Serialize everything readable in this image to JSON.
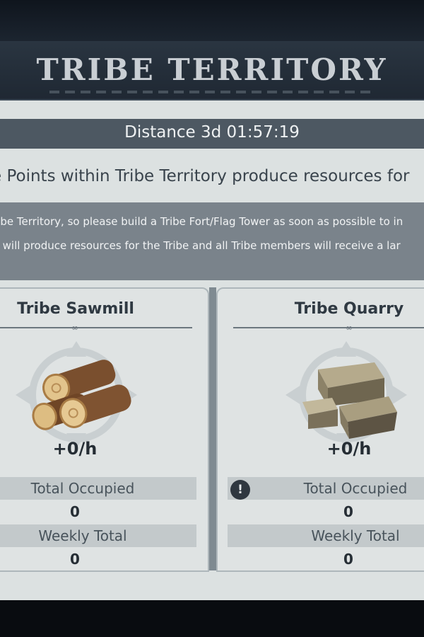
{
  "header": {
    "title": "TRIBE TERRITORY",
    "distance": "Distance 3d 01:57:19"
  },
  "intro_text": "e Points within Tribe Territory produce resources for",
  "info": {
    "line1": "ribe Territory, so please build a Tribe Fort/Flag Tower as soon as possible to in",
    "line2": "y will produce resources for the Tribe and all Tribe members will receive a lar"
  },
  "sawmill": {
    "title": "Tribe Sawmill",
    "icon": "wood-logs-icon",
    "rate": "+0/h",
    "total_occupied_label": "Total Occupied",
    "total_occupied_value": "0",
    "weekly_total_label": "Weekly Total",
    "weekly_total_value": "0"
  },
  "quarry": {
    "title": "Tribe Quarry",
    "icon": "stone-blocks-icon",
    "rate": "+0/h",
    "warning_icon": "!",
    "total_occupied_label": "Total Occupied",
    "total_occupied_value": "0",
    "weekly_total_label": "Weekly Total",
    "weekly_total_value": "0"
  }
}
